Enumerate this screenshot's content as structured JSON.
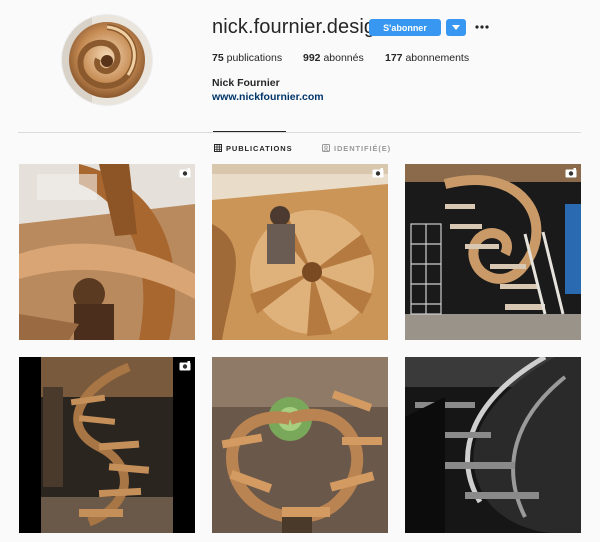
{
  "profile": {
    "username": "nick.fournier.designs",
    "follow_label": "S'abonner",
    "full_name": "Nick Fournier",
    "website": "www.nickfournier.com",
    "stats": {
      "posts_count": "75",
      "posts_label": "publications",
      "followers_count": "992",
      "followers_label": "abonnés",
      "following_count": "177",
      "following_label": "abonnements"
    }
  },
  "tabs": [
    {
      "label": "PUBLICATIONS",
      "icon": "grid-icon",
      "active": true
    },
    {
      "label": "IDENTIFIÉ(E)",
      "icon": "tagged-icon",
      "active": false
    }
  ],
  "posts": [
    {
      "subject": "spiral-staircase-under-construction",
      "badge": "video-icon"
    },
    {
      "subject": "worker-shaping-stair-treads",
      "badge": "video-icon"
    },
    {
      "subject": "spiral-staircase-with-scaffolding",
      "badge": "video-icon"
    },
    {
      "subject": "wooden-spiral-staircase-in-workshop",
      "badge": "video-icon"
    },
    {
      "subject": "spiral-staircase-looking-up",
      "badge": null
    },
    {
      "subject": "black-and-white-spiral-staircase",
      "badge": null
    }
  ],
  "colors": {
    "accent": "#3897f0",
    "link": "#003569",
    "background": "#fafafa",
    "divider": "#dbdbdb"
  }
}
